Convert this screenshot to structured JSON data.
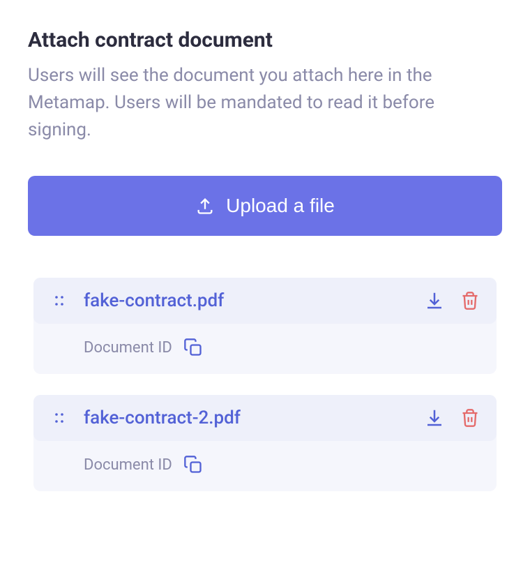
{
  "header": {
    "title": "Attach contract document",
    "description": "Users will see the document you attach here in the Metamap. Users will be mandated to read it before signing."
  },
  "upload": {
    "button_label": "Upload a file"
  },
  "files": [
    {
      "name": "fake-contract.pdf",
      "doc_id_label": "Document ID"
    },
    {
      "name": "fake-contract-2.pdf",
      "doc_id_label": "Document ID"
    }
  ]
}
